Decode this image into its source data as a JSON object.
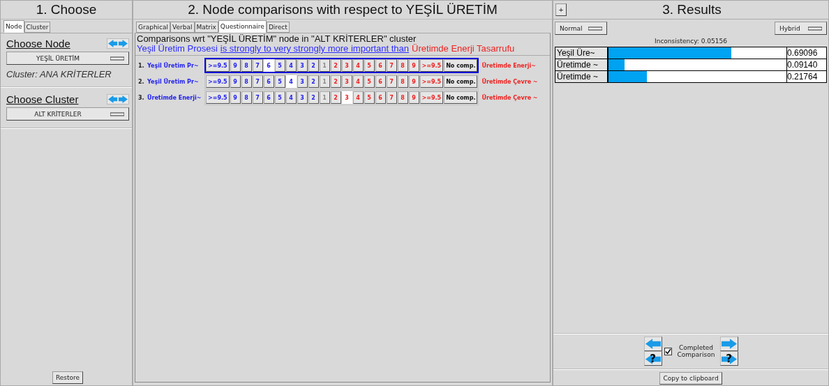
{
  "choose": {
    "title": "1. Choose",
    "tabs": [
      {
        "label": "Node",
        "selected": true
      },
      {
        "label": "Cluster",
        "selected": false
      }
    ],
    "node_heading": "Choose Node",
    "node_dropdown": "YEŞİL ÜRETİM",
    "cluster_info": "Cluster: ANA KRİTERLER",
    "cluster_heading": "Choose Cluster",
    "cluster_dropdown": "ALT KRİTERLER",
    "restore_button": "Restore"
  },
  "comparisons": {
    "title": "2. Node comparisons with respect to YEŞİL ÜRETİM",
    "tabs": [
      {
        "label": "Graphical",
        "selected": false
      },
      {
        "label": "Verbal",
        "selected": false
      },
      {
        "label": "Matrix",
        "selected": false
      },
      {
        "label": "Questionnaire",
        "selected": true
      },
      {
        "label": "Direct",
        "selected": false
      }
    ],
    "heading": "Comparisons wrt \"YEŞİL ÜRETİM\" node in \"ALT KRİTERLER\" cluster",
    "verdict": [
      {
        "text": "Yeşil Üretim Prosesi",
        "kind": "left"
      },
      {
        "text": "is strongly to very strongly more important than",
        "kind": "phrase"
      },
      {
        "text": "Üretimde Enerji Tasarrufu",
        "kind": "right"
      }
    ],
    "rows": [
      {
        "number": "1.",
        "left": "Yeşil Üretim Pr~",
        "right": "Üretimde Enerji~",
        "focused": true,
        "cells": [
          {
            "label": ">=9.5",
            "kind": "left",
            "selected": false
          },
          {
            "label": "9",
            "kind": "left",
            "selected": false
          },
          {
            "label": "8",
            "kind": "left",
            "selected": false
          },
          {
            "label": "7",
            "kind": "left",
            "selected": false
          },
          {
            "label": "6",
            "kind": "left",
            "selected": true
          },
          {
            "label": "5",
            "kind": "left",
            "selected": false
          },
          {
            "label": "4",
            "kind": "left",
            "selected": false
          },
          {
            "label": "3",
            "kind": "left",
            "selected": false
          },
          {
            "label": "2",
            "kind": "left",
            "selected": false
          },
          {
            "label": "1",
            "kind": "equal",
            "selected": false
          },
          {
            "label": "2",
            "kind": "right",
            "selected": false
          },
          {
            "label": "3",
            "kind": "right",
            "selected": false
          },
          {
            "label": "4",
            "kind": "right",
            "selected": false
          },
          {
            "label": "5",
            "kind": "right",
            "selected": false
          },
          {
            "label": "6",
            "kind": "right",
            "selected": false
          },
          {
            "label": "7",
            "kind": "right",
            "selected": false
          },
          {
            "label": "8",
            "kind": "right",
            "selected": false
          },
          {
            "label": "9",
            "kind": "right",
            "selected": false
          },
          {
            "label": ">=9.5",
            "kind": "right",
            "selected": false
          },
          {
            "label": "No comp.",
            "kind": "none",
            "selected": false
          }
        ]
      },
      {
        "number": "2.",
        "left": "Yeşil Üretim Pr~",
        "right": "Üretimde Çevre ~",
        "focused": false,
        "cells": [
          {
            "label": ">=9.5",
            "kind": "left",
            "selected": false
          },
          {
            "label": "9",
            "kind": "left",
            "selected": false
          },
          {
            "label": "8",
            "kind": "left",
            "selected": false
          },
          {
            "label": "7",
            "kind": "left",
            "selected": false
          },
          {
            "label": "6",
            "kind": "left",
            "selected": false
          },
          {
            "label": "5",
            "kind": "left",
            "selected": false
          },
          {
            "label": "4",
            "kind": "left",
            "selected": true
          },
          {
            "label": "3",
            "kind": "left",
            "selected": false
          },
          {
            "label": "2",
            "kind": "left",
            "selected": false
          },
          {
            "label": "1",
            "kind": "equal",
            "selected": false
          },
          {
            "label": "2",
            "kind": "right",
            "selected": false
          },
          {
            "label": "3",
            "kind": "right",
            "selected": false
          },
          {
            "label": "4",
            "kind": "right",
            "selected": false
          },
          {
            "label": "5",
            "kind": "right",
            "selected": false
          },
          {
            "label": "6",
            "kind": "right",
            "selected": false
          },
          {
            "label": "7",
            "kind": "right",
            "selected": false
          },
          {
            "label": "8",
            "kind": "right",
            "selected": false
          },
          {
            "label": "9",
            "kind": "right",
            "selected": false
          },
          {
            "label": ">=9.5",
            "kind": "right",
            "selected": false
          },
          {
            "label": "No comp.",
            "kind": "none",
            "selected": false
          }
        ]
      },
      {
        "number": "3.",
        "left": "Üretimde Enerji~",
        "right": "Üretimde Çevre ~",
        "focused": false,
        "cells": [
          {
            "label": ">=9.5",
            "kind": "left",
            "selected": false
          },
          {
            "label": "9",
            "kind": "left",
            "selected": false
          },
          {
            "label": "8",
            "kind": "left",
            "selected": false
          },
          {
            "label": "7",
            "kind": "left",
            "selected": false
          },
          {
            "label": "6",
            "kind": "left",
            "selected": false
          },
          {
            "label": "5",
            "kind": "left",
            "selected": false
          },
          {
            "label": "4",
            "kind": "left",
            "selected": false
          },
          {
            "label": "3",
            "kind": "left",
            "selected": false
          },
          {
            "label": "2",
            "kind": "left",
            "selected": false
          },
          {
            "label": "1",
            "kind": "equal",
            "selected": false
          },
          {
            "label": "2",
            "kind": "right",
            "selected": false
          },
          {
            "label": "3",
            "kind": "right",
            "selected": true
          },
          {
            "label": "4",
            "kind": "right",
            "selected": false
          },
          {
            "label": "5",
            "kind": "right",
            "selected": false
          },
          {
            "label": "6",
            "kind": "right",
            "selected": false
          },
          {
            "label": "7",
            "kind": "right",
            "selected": false
          },
          {
            "label": "8",
            "kind": "right",
            "selected": false
          },
          {
            "label": "9",
            "kind": "right",
            "selected": false
          },
          {
            "label": ">=9.5",
            "kind": "right",
            "selected": false
          },
          {
            "label": "No comp.",
            "kind": "none",
            "selected": false
          }
        ]
      }
    ]
  },
  "results": {
    "expand_button": "+",
    "title": "3. Results",
    "mode_dropdown": "Normal",
    "method_dropdown": "Hybrid",
    "inconsistency": "Inconsistency: 0.05156",
    "rows": [
      {
        "name": "Yeşil Üre~",
        "level": 0.69096,
        "value": "0.69096"
      },
      {
        "name": "Üretimde ~",
        "level": 0.0914,
        "value": "0.09140"
      },
      {
        "name": "Üretimde ~",
        "level": 0.21764,
        "value": "0.21764"
      }
    ],
    "unfinished_mark": "?",
    "completed_label": "Completed Comparison",
    "completed": true,
    "copy_button": "Copy to clipboard"
  }
}
